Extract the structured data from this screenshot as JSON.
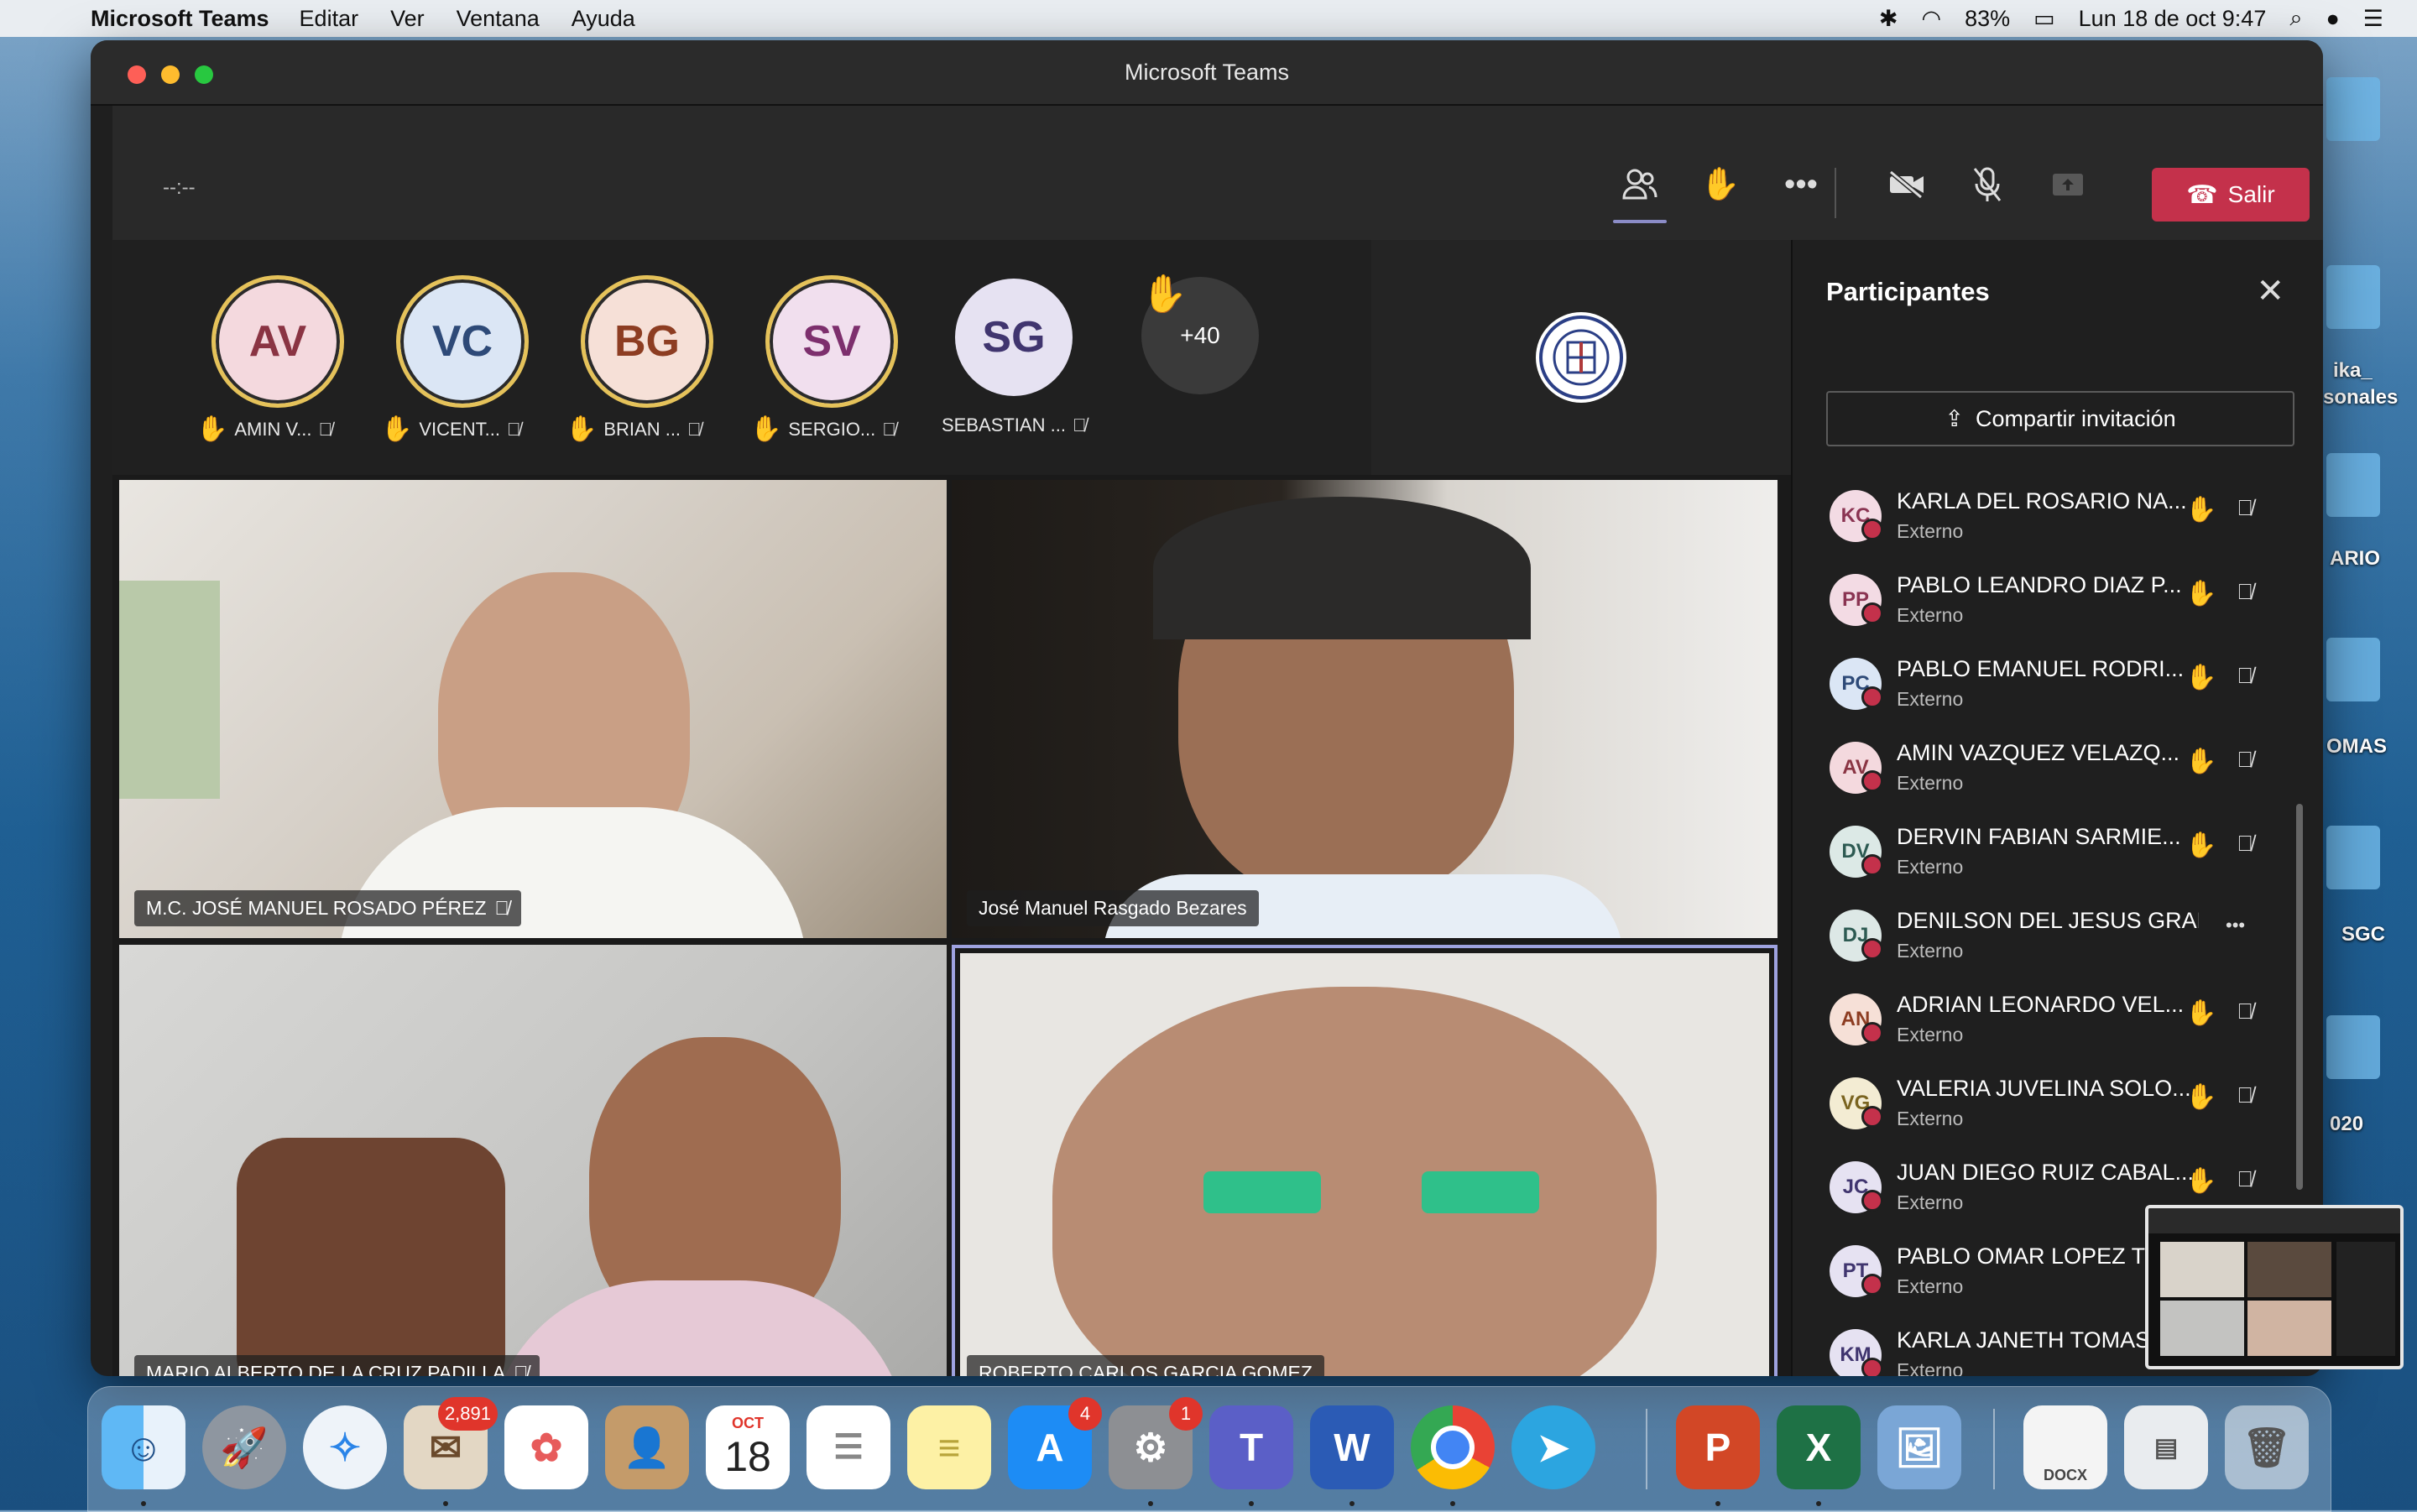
{
  "menubar": {
    "app": "Microsoft Teams",
    "items": [
      "Editar",
      "Ver",
      "Ventana",
      "Ayuda"
    ],
    "battery": "83%",
    "clock": "Lun 18 de oct  9:47"
  },
  "desktop_labels": [
    "ika_",
    "sonales",
    "ARIO",
    "OMAS",
    "SGC",
    "020"
  ],
  "window": {
    "title": "Microsoft Teams"
  },
  "toolbar": {
    "timer": "--:--",
    "leave_label": "Salir"
  },
  "avatars": [
    {
      "initials": "AV",
      "name": "AMIN V...",
      "hand": true,
      "bg": "#f4d9de",
      "fg": "#8a3443"
    },
    {
      "initials": "VC",
      "name": "VICENT...",
      "hand": true,
      "bg": "#dbe6f5",
      "fg": "#2e4a78"
    },
    {
      "initials": "BG",
      "name": "BRIAN ...",
      "hand": true,
      "bg": "#f6e0d7",
      "fg": "#8d3d22"
    },
    {
      "initials": "SV",
      "name": "SERGIO...",
      "hand": true,
      "bg": "#f1dfee",
      "fg": "#7d2f6d"
    },
    {
      "initials": "SG",
      "name": "SEBASTIAN ...",
      "hand": false,
      "bg": "#e6e2f2",
      "fg": "#40356f"
    }
  ],
  "overflow_count": "+40",
  "video_tiles": [
    {
      "name": "M.C. JOSÉ MANUEL ROSADO PÉREZ",
      "muted": true
    },
    {
      "name": "José Manuel Rasgado Bezares",
      "muted": false
    },
    {
      "name": "MARIO ALBERTO DE LA CRUZ PADILLA",
      "muted": true
    },
    {
      "name": "ROBERTO CARLOS GARCIA GOMEZ",
      "muted": false
    }
  ],
  "panel": {
    "title": "Participantes",
    "invite_label": "Compartir invitación",
    "participants": [
      {
        "initials": "KC",
        "name": "KARLA DEL ROSARIO NA...",
        "role": "Externo",
        "hand": true,
        "muted": true,
        "bg": "#f3dbe4",
        "fg": "#8a3452"
      },
      {
        "initials": "PP",
        "name": "PABLO LEANDRO DIAZ P...",
        "role": "Externo",
        "hand": true,
        "muted": true,
        "bg": "#f3dbe4",
        "fg": "#8a3452"
      },
      {
        "initials": "PC",
        "name": "PABLO EMANUEL RODRI...",
        "role": "Externo",
        "hand": true,
        "muted": true,
        "bg": "#dbe6f5",
        "fg": "#2e4a78"
      },
      {
        "initials": "AV",
        "name": "AMIN VAZQUEZ VELAZQ...",
        "role": "Externo",
        "hand": true,
        "muted": true,
        "bg": "#f4d9de",
        "fg": "#8a3443"
      },
      {
        "initials": "DV",
        "name": "DERVIN FABIAN SARMIE...",
        "role": "Externo",
        "hand": true,
        "muted": true,
        "bg": "#dce9e6",
        "fg": "#2d5a52"
      },
      {
        "initials": "DJ",
        "name": "DENILSON DEL JESUS GRAFF...",
        "role": "Externo",
        "hand": false,
        "muted": false,
        "bg": "#dde8e6",
        "fg": "#2d5a52"
      },
      {
        "initials": "AN",
        "name": "ADRIAN LEONARDO VEL...",
        "role": "Externo",
        "hand": true,
        "muted": true,
        "bg": "#f6e0d7",
        "fg": "#8d3d22"
      },
      {
        "initials": "VG",
        "name": "VALERIA JUVELINA SOLO...",
        "role": "Externo",
        "hand": true,
        "muted": true,
        "bg": "#f3ecd3",
        "fg": "#7a6420"
      },
      {
        "initials": "JC",
        "name": "JUAN DIEGO RUIZ CABAL...",
        "role": "Externo",
        "hand": true,
        "muted": true,
        "bg": "#e6e2f2",
        "fg": "#40356f"
      },
      {
        "initials": "PT",
        "name": "PABLO OMAR LOPEZ TE",
        "role": "Externo",
        "hand": false,
        "muted": false,
        "bg": "#e6e2f2",
        "fg": "#40356f"
      },
      {
        "initials": "KM",
        "name": "KARLA JANETH TOMAS",
        "role": "Externo",
        "hand": false,
        "muted": false,
        "bg": "#e6e2f2",
        "fg": "#40356f"
      }
    ]
  },
  "dock": {
    "mail_badge": "2,891",
    "calendar_month": "OCT",
    "calendar_day": "18",
    "appstore_badge": "4",
    "settings_badge": "1",
    "docx_label": "DOCX"
  }
}
